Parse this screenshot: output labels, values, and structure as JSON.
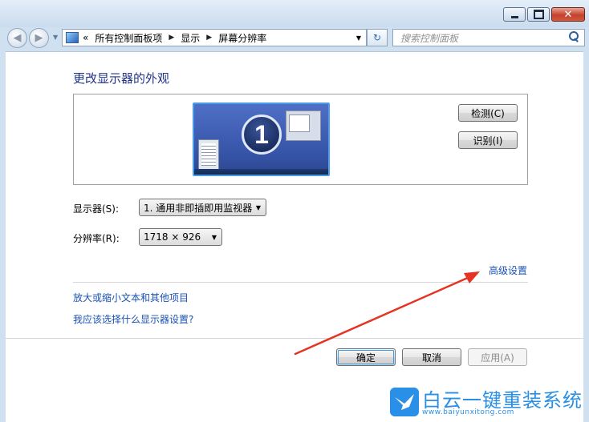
{
  "window": {
    "minimize_icon": "minimize-icon",
    "maximize_icon": "maximize-icon",
    "close_label": "✕"
  },
  "nav": {
    "back_glyph": "◀",
    "forward_glyph": "▶",
    "crumb_prefix": "«",
    "breadcrumbs": [
      "所有控制面板项",
      "显示",
      "屏幕分辨率"
    ],
    "refresh_glyph": "↻",
    "search_placeholder": "搜索控制面板"
  },
  "main": {
    "title": "更改显示器的外观",
    "monitor_number": "1",
    "detect_label": "检测(C)",
    "identify_label": "识别(I)",
    "display_label": "显示器(S):",
    "display_value": "1. 通用非即插即用监视器",
    "resolution_label": "分辨率(R):",
    "resolution_value": "1718 × 926",
    "advanced_link": "高级设置",
    "text_size_link": "放大或缩小文本和其他项目",
    "which_settings_link": "我应该选择什么显示器设置?",
    "ok_label": "确定",
    "cancel_label": "取消",
    "apply_label": "应用(A)"
  },
  "watermark": {
    "main": "白云一键重装系统",
    "sub": "www.baiyunxitong.com"
  },
  "colors": {
    "link": "#1a52b4",
    "title": "#1e3287",
    "annotation_arrow": "#e53424",
    "watermark": "#2a8fe6"
  }
}
